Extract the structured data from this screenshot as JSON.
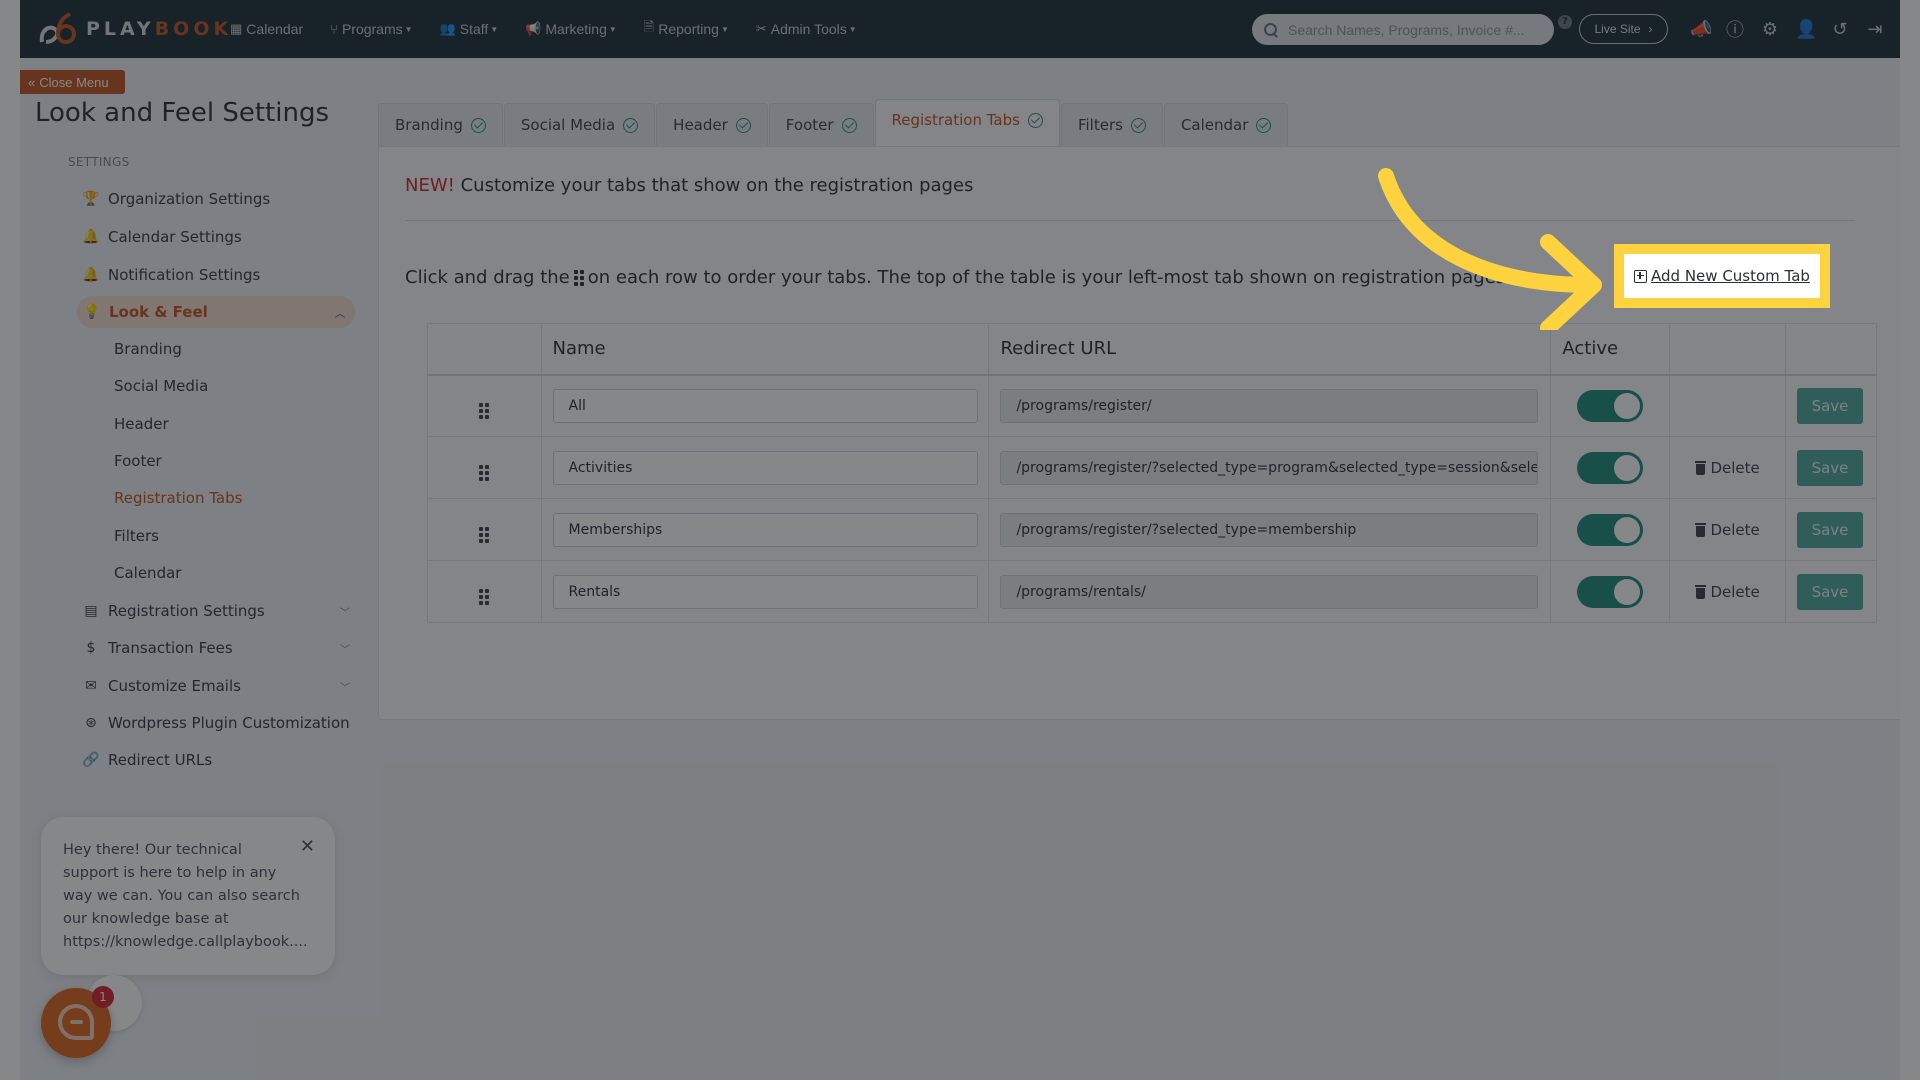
{
  "header": {
    "logo_play": "PLAY",
    "logo_book": "BOOK",
    "nav": [
      {
        "label": "Calendar",
        "icon": "calendar-icon",
        "dropdown": false
      },
      {
        "label": "Programs",
        "icon": "branch-icon",
        "dropdown": true
      },
      {
        "label": "Staff",
        "icon": "users-icon",
        "dropdown": true
      },
      {
        "label": "Marketing",
        "icon": "megaphone-icon",
        "dropdown": true
      },
      {
        "label": "Reporting",
        "icon": "file-icon",
        "dropdown": true
      },
      {
        "label": "Admin Tools",
        "icon": "tools-icon",
        "dropdown": true
      }
    ],
    "search_placeholder": "Search Names, Programs, Invoice #...",
    "search_help": "?",
    "live_site": "Live Site",
    "icons": [
      "announcement-icon",
      "help-icon",
      "gear-icon",
      "add-user-icon",
      "history-icon",
      "logout-icon"
    ]
  },
  "sidebar": {
    "close_menu": "Close Menu",
    "title": "Look and Feel Settings",
    "section_label": "SETTINGS",
    "items": [
      {
        "label": "Organization Settings",
        "icon": "trophy-icon"
      },
      {
        "label": "Calendar Settings",
        "icon": "bell-icon"
      },
      {
        "label": "Notification Settings",
        "icon": "bell-icon"
      },
      {
        "label": "Look & Feel",
        "icon": "lightbulb-icon",
        "active": true,
        "expanded": true
      },
      {
        "label": "Registration Settings",
        "icon": "form-icon",
        "collapsible": true
      },
      {
        "label": "Transaction Fees",
        "icon": "dollar-icon",
        "collapsible": true
      },
      {
        "label": "Customize Emails",
        "icon": "envelope-icon",
        "collapsible": true
      },
      {
        "label": "Wordpress Plugin Customization",
        "icon": "wordpress-icon"
      },
      {
        "label": "Redirect URLs",
        "icon": "link-icon"
      }
    ],
    "sub_items": [
      {
        "label": "Branding"
      },
      {
        "label": "Social Media"
      },
      {
        "label": "Header"
      },
      {
        "label": "Footer"
      },
      {
        "label": "Registration Tabs",
        "active": true
      },
      {
        "label": "Filters"
      },
      {
        "label": "Calendar"
      }
    ]
  },
  "tabs": [
    {
      "label": "Branding",
      "complete": true
    },
    {
      "label": "Social Media",
      "complete": true
    },
    {
      "label": "Header",
      "complete": true
    },
    {
      "label": "Footer",
      "complete": true
    },
    {
      "label": "Registration Tabs",
      "complete": true,
      "active": true
    },
    {
      "label": "Filters",
      "complete": true
    },
    {
      "label": "Calendar",
      "complete": true
    }
  ],
  "main": {
    "new_badge": "NEW!",
    "heading": "Customize your tabs that show on the registration pages",
    "instruction_before": "Click and drag the",
    "instruction_after": "on each row to order your tabs. The top of the table is your left-most tab shown on registration pages.",
    "add_button": "Add New Custom Tab",
    "columns": [
      "",
      "Name",
      "Redirect URL",
      "Active",
      "",
      ""
    ],
    "rows": [
      {
        "name": "All",
        "url": "/programs/register/",
        "active": true,
        "deletable": false,
        "delete_label": "",
        "save_label": "Save"
      },
      {
        "name": "Activities",
        "url": "/programs/register/?selected_type=program&selected_type=session&selected_type=",
        "active": true,
        "deletable": true,
        "delete_label": "Delete",
        "save_label": "Save"
      },
      {
        "name": "Memberships",
        "url": "/programs/register/?selected_type=membership",
        "active": true,
        "deletable": true,
        "delete_label": "Delete",
        "save_label": "Save"
      },
      {
        "name": "Rentals",
        "url": "/programs/rentals/",
        "active": true,
        "deletable": true,
        "delete_label": "Delete",
        "save_label": "Save"
      }
    ]
  },
  "chat": {
    "message": "Hey there! Our technical support is here to help in any way we can. You can also search our knowledge base at https://knowledge.callplaybook....",
    "badge_count": "1"
  },
  "colors": {
    "brand": "#c0531f",
    "header_bg": "#1d2c38",
    "accent_teal": "#1f8a7a",
    "highlight": "#ffd23f",
    "new_red": "#d0261f"
  }
}
